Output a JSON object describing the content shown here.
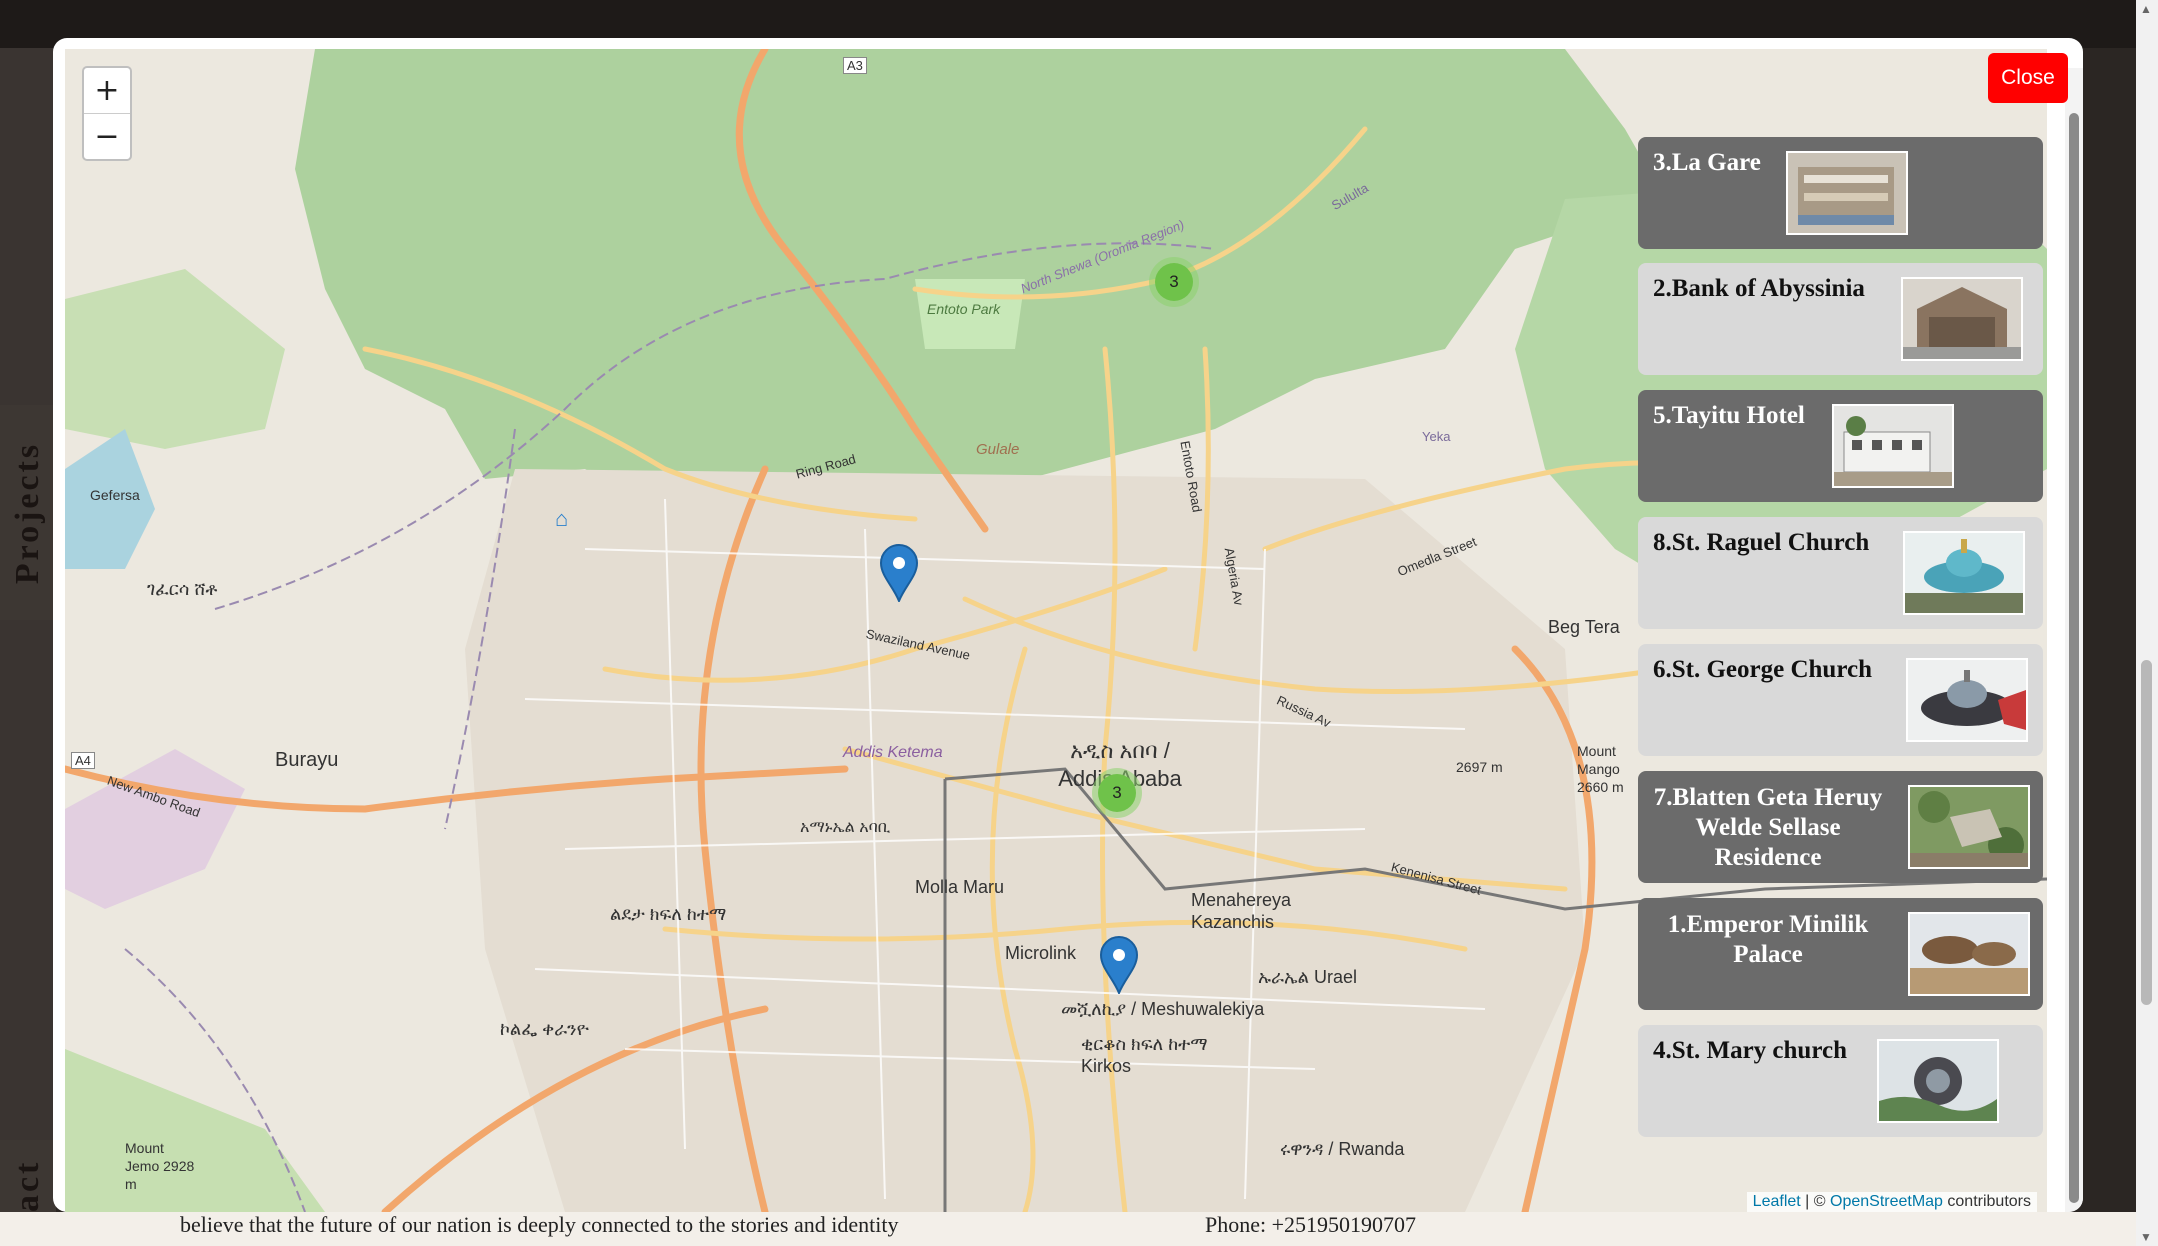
{
  "page": {
    "side_tabs": [
      "Projects",
      "tact"
    ],
    "bottom_text_left": "believe that the future of our nation is deeply connected to the stories and identity",
    "bottom_text_right": "Phone: +251950190707"
  },
  "modal": {
    "close_label": "Close",
    "zoom_in": "+",
    "zoom_out": "−",
    "attribution": {
      "leaflet": "Leaflet",
      "sep": " | © ",
      "osm": "OpenStreetMap",
      "suffix": " contributors"
    }
  },
  "map": {
    "place_labels": [
      "Burayu",
      "Gefersa",
      "Entoto Park",
      "Gulale",
      "Addis Ketema",
      "Molla Maru",
      "Microlink",
      "Menahereya Kazanchis",
      "Beg Tera",
      "ኡራኤል Urael",
      "መሿለኪያ / Meshuwalekiya",
      "ቂርቆስ ክፍለ ከተማ Kirkos",
      "ሩዋንዳ / Rwanda",
      "Mount Mango 2660 m",
      "Mount Jemo 2928 m",
      "2697 m",
      "አዲስ አበባ / Addis Ababa",
      "ገፈርሳ ሸቶ",
      "አማኑኤል አባቢ",
      "ልደታ ክፍለ ከተማ",
      "ኮልፌ ቀራንዮ"
    ],
    "road_labels": [
      "A3",
      "A4",
      "Ring Road",
      "Swaziland Avenue",
      "North Shewa (Oromia Region)",
      "Entoto Road",
      "Algeria Av",
      "Omedla Street",
      "Russia Av",
      "Kenenisa Street",
      "New Ambo Road",
      "Sululta",
      "Yeka"
    ],
    "clusters": [
      {
        "count": "3"
      },
      {
        "count": "3"
      }
    ],
    "markers": [
      "marker-north",
      "marker-center"
    ]
  },
  "projects": [
    {
      "title": "3.La Gare",
      "style": "dark"
    },
    {
      "title": "2.Bank of Abyssinia",
      "style": "light"
    },
    {
      "title": "5.Tayitu Hotel",
      "style": "dark"
    },
    {
      "title": "8.St. Raguel Church",
      "style": "light"
    },
    {
      "title": "6.St. George Church",
      "style": "light"
    },
    {
      "title": "7.Blatten Geta Heruy Welde Sellase Residence",
      "style": "dark"
    },
    {
      "title": "1.Emperor Minilik Palace",
      "style": "dark"
    },
    {
      "title": "4.St. Mary church",
      "style": "light"
    }
  ],
  "colors": {
    "close": "#ff0000",
    "card_dark": "#6b6b6b",
    "card_light": "#d9d9d9",
    "forest": "#a9d49a",
    "marker": "#2a7fcc",
    "cluster": "#6fc24a"
  }
}
